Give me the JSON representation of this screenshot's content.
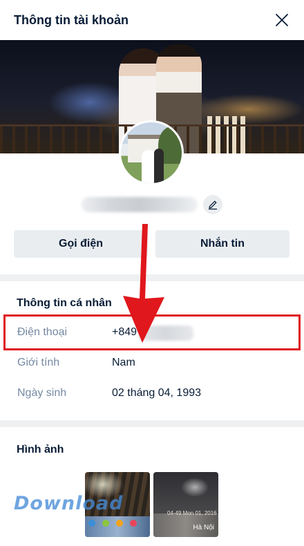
{
  "header": {
    "title": "Thông tin tài khoản"
  },
  "profile": {
    "name_hidden": true
  },
  "actions": {
    "call_label": "Gọi điện",
    "message_label": "Nhắn tin"
  },
  "personal_info": {
    "section_title": "Thông tin cá nhân",
    "rows": [
      {
        "label": "Điện thoại",
        "value": "+849"
      },
      {
        "label": "Giới tính",
        "value": "Nam"
      },
      {
        "label": "Ngày sinh",
        "value": "02 tháng 04, 1993"
      }
    ]
  },
  "photos": {
    "section_title": "Hình ảnh",
    "items": [
      {
        "caption": ""
      },
      {
        "caption": "Hà Nội",
        "date": "04-49 Mon 01, 2016"
      }
    ]
  },
  "watermark": {
    "text": "Download"
  },
  "colors": {
    "text_primary": "#081c36",
    "text_secondary": "#7589a3",
    "button_bg": "#eaedf0",
    "divider": "#eef0f1",
    "annotation_red": "#e0171c"
  }
}
